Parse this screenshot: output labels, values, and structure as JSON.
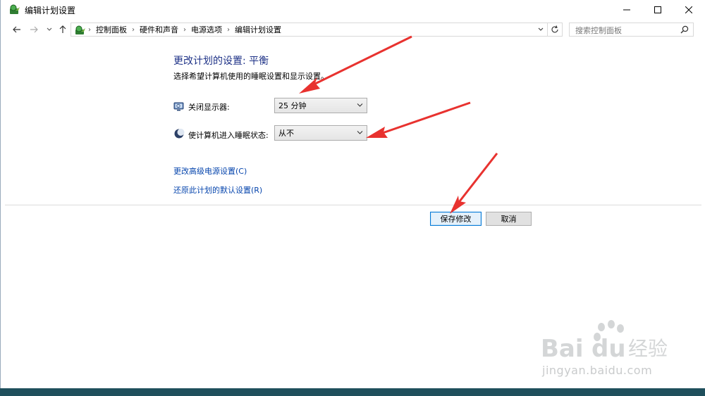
{
  "window": {
    "title": "编辑计划设置"
  },
  "nav": {
    "breadcrumbs": [
      "控制面板",
      "硬件和声音",
      "电源选项",
      "编辑计划设置"
    ],
    "search_placeholder": "搜索控制面板"
  },
  "content": {
    "heading": "更改计划的设置: 平衡",
    "subtext": "选择希望计算机使用的睡眠设置和显示设置。",
    "display_off": {
      "label": "关闭显示器:",
      "value": "25 分钟"
    },
    "sleep": {
      "label": "使计算机进入睡眠状态:",
      "value": "从不"
    },
    "link_advanced": "更改高级电源设置(C)",
    "link_restore": "还原此计划的默认设置(R)"
  },
  "buttons": {
    "save": "保存修改",
    "cancel": "取消"
  },
  "watermark": {
    "logo": "Bai du 经验",
    "url": "jingyan.baidu.com"
  },
  "colors": {
    "heading": "#1e3287",
    "link": "#0645ad",
    "arrow": "#e8322f",
    "primary_border": "#0078d7"
  }
}
